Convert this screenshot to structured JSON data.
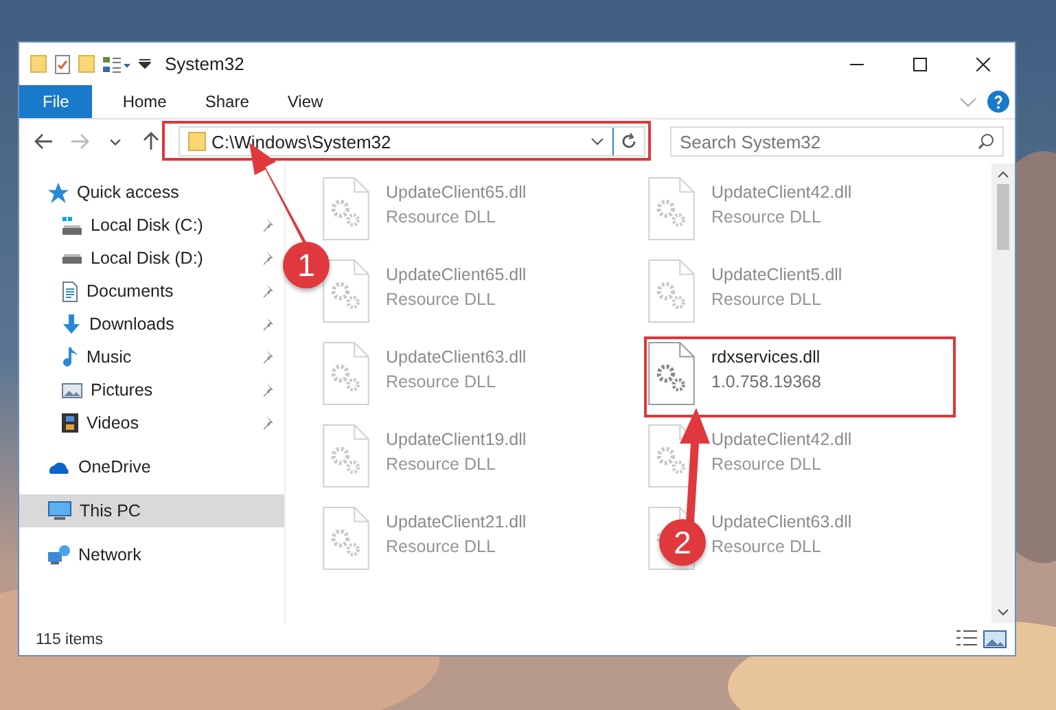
{
  "window": {
    "title": "System32"
  },
  "ribbon": {
    "tabs": [
      {
        "label": "File",
        "kind": "file"
      },
      {
        "label": "Home",
        "kind": "tab"
      },
      {
        "label": "Share",
        "kind": "tab"
      },
      {
        "label": "View",
        "kind": "tab"
      }
    ]
  },
  "address_bar": {
    "path": "C:\\Windows\\System32"
  },
  "search": {
    "placeholder": "Search System32"
  },
  "sidebar": {
    "items": [
      {
        "label": "Quick access",
        "kind": "star",
        "selected": false,
        "children": [
          {
            "label": "Local Disk (C:)",
            "kind": "system",
            "selected": false,
            "pinned": true
          },
          {
            "label": "Local Disk (D:)",
            "kind": "drive",
            "selected": false,
            "pinned": true
          },
          {
            "label": "Documents",
            "kind": "documents",
            "selected": false,
            "pinned": true
          },
          {
            "label": "Downloads",
            "kind": "downloads",
            "selected": false,
            "pinned": true
          },
          {
            "label": "Music",
            "kind": "music",
            "selected": false,
            "pinned": true
          },
          {
            "label": "Pictures",
            "kind": "pictures",
            "selected": false,
            "pinned": true
          },
          {
            "label": "Videos",
            "kind": "videos",
            "selected": false,
            "pinned": true
          }
        ]
      },
      {
        "label": "OneDrive",
        "kind": "cloud",
        "selected": false
      },
      {
        "label": "This PC",
        "kind": "computer",
        "selected": true
      },
      {
        "label": "Network",
        "kind": "network",
        "selected": false
      }
    ]
  },
  "files": [
    {
      "name": "UpdateClient65.dll",
      "detail": "Resource DLL",
      "faded": true
    },
    {
      "name": "UpdateClient42.dll",
      "detail": "Resource DLL",
      "faded": true
    },
    {
      "name": "UpdateClient65.dll",
      "detail": "Resource DLL",
      "faded": true
    },
    {
      "name": "UpdateClient5.dll",
      "detail": "Resource DLL",
      "faded": true
    },
    {
      "name": "UpdateClient63.dll",
      "detail": "Resource DLL",
      "faded": true
    },
    {
      "name": "rdxservices.dll",
      "detail": "1.0.758.19368",
      "faded": false
    },
    {
      "name": "UpdateClient19.dll",
      "detail": "Resource DLL",
      "faded": true
    },
    {
      "name": "UpdateClient42.dll",
      "detail": "Resource DLL",
      "faded": true
    },
    {
      "name": "UpdateClient21.dll",
      "detail": "Resource DLL",
      "faded": true
    },
    {
      "name": "UpdateClient63.dll",
      "detail": "Resource DLL",
      "faded": true
    }
  ],
  "status_bar": {
    "text": "115 items"
  },
  "callouts": [
    {
      "number": "1"
    },
    {
      "number": "2"
    }
  ]
}
